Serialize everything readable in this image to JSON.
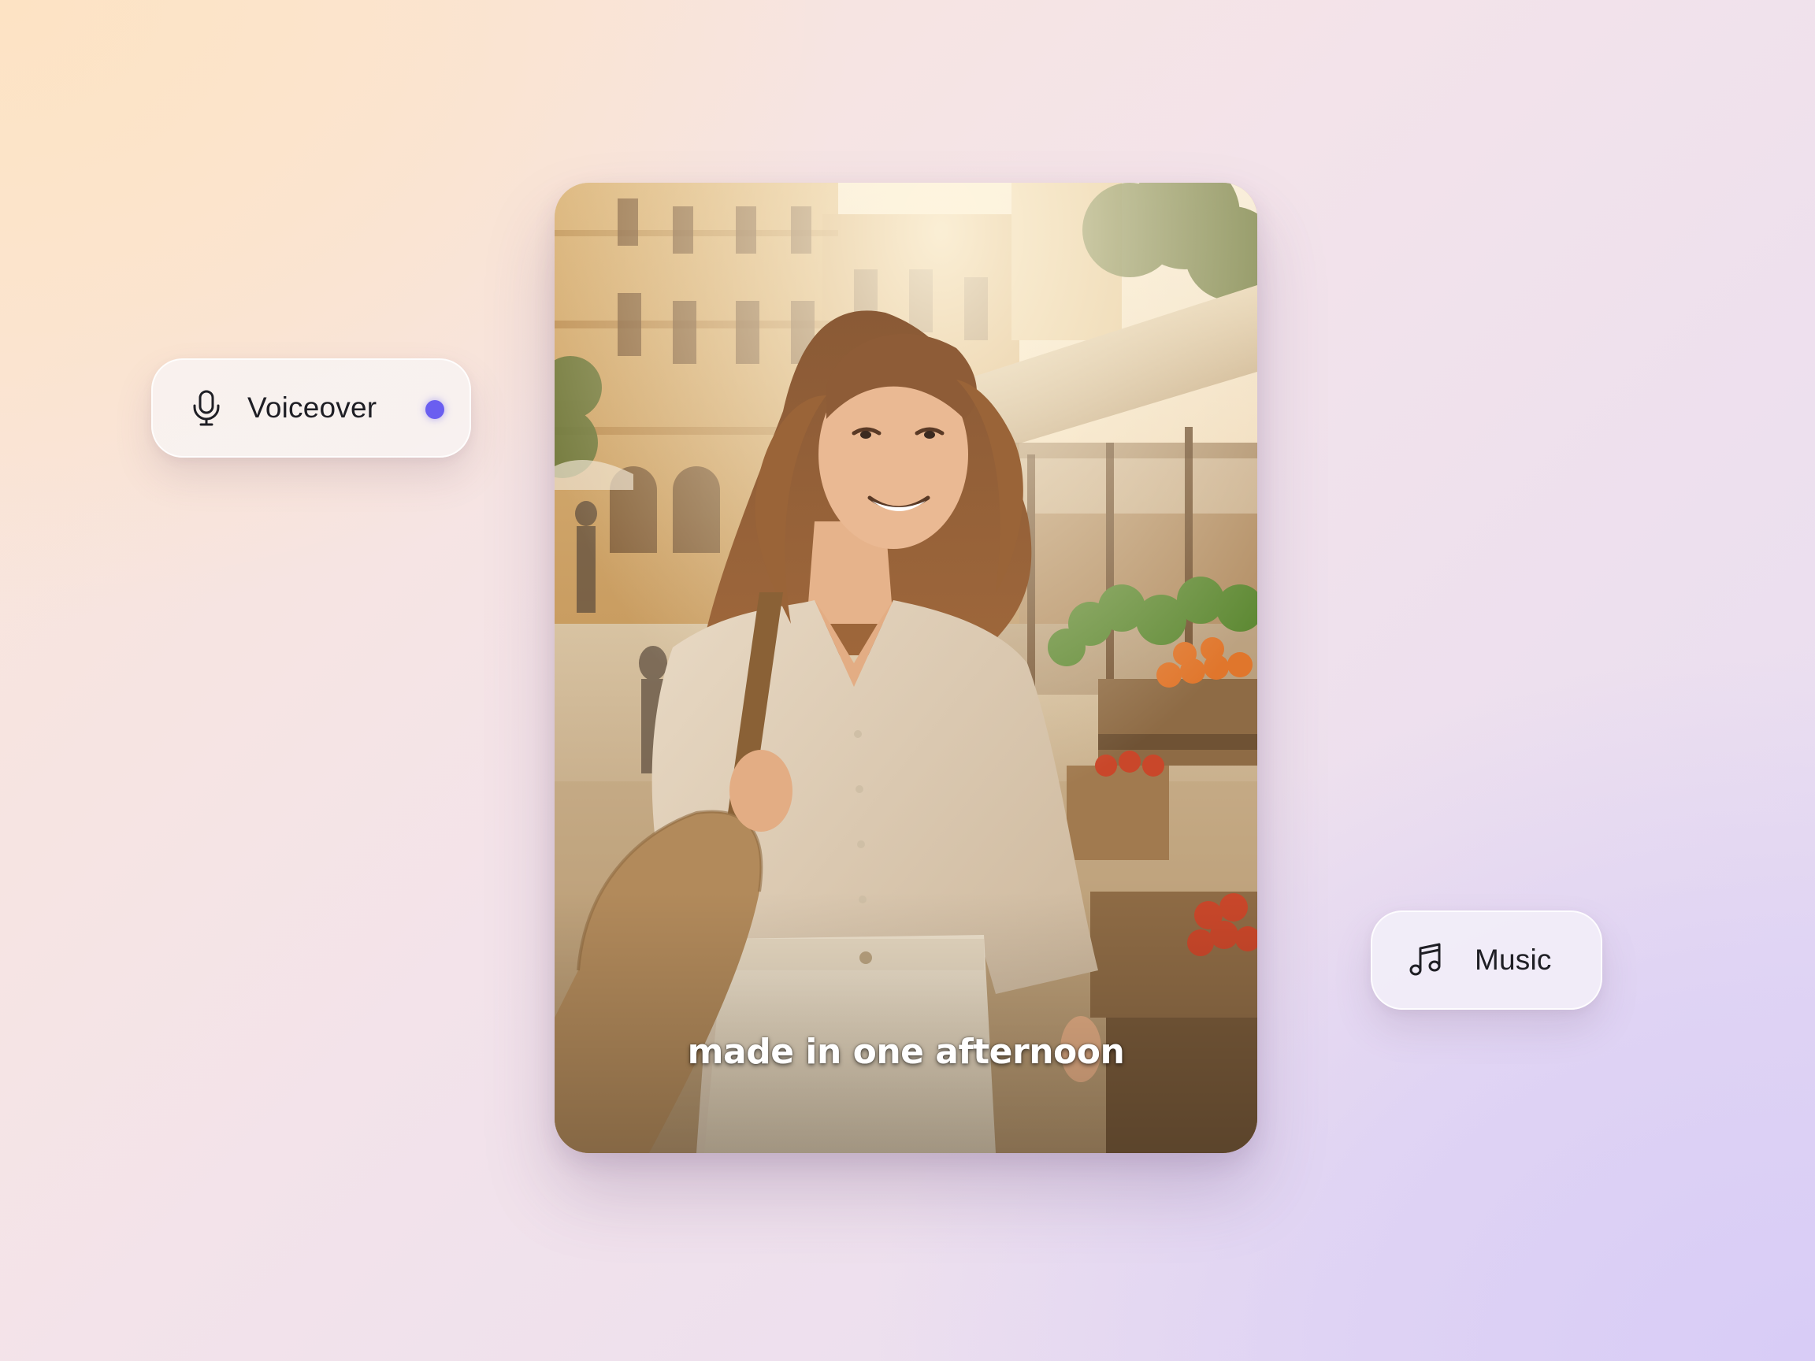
{
  "colors": {
    "record_dot": "#6a5ef0",
    "text": "#1f1f25",
    "caption": "#ffffff"
  },
  "voiceover": {
    "label": "Voiceover",
    "icon": "microphone-icon",
    "recording_indicator": "recording-dot"
  },
  "music": {
    "label": "Music",
    "icon": "music-note-icon"
  },
  "video": {
    "caption": "made in one afternoon"
  }
}
